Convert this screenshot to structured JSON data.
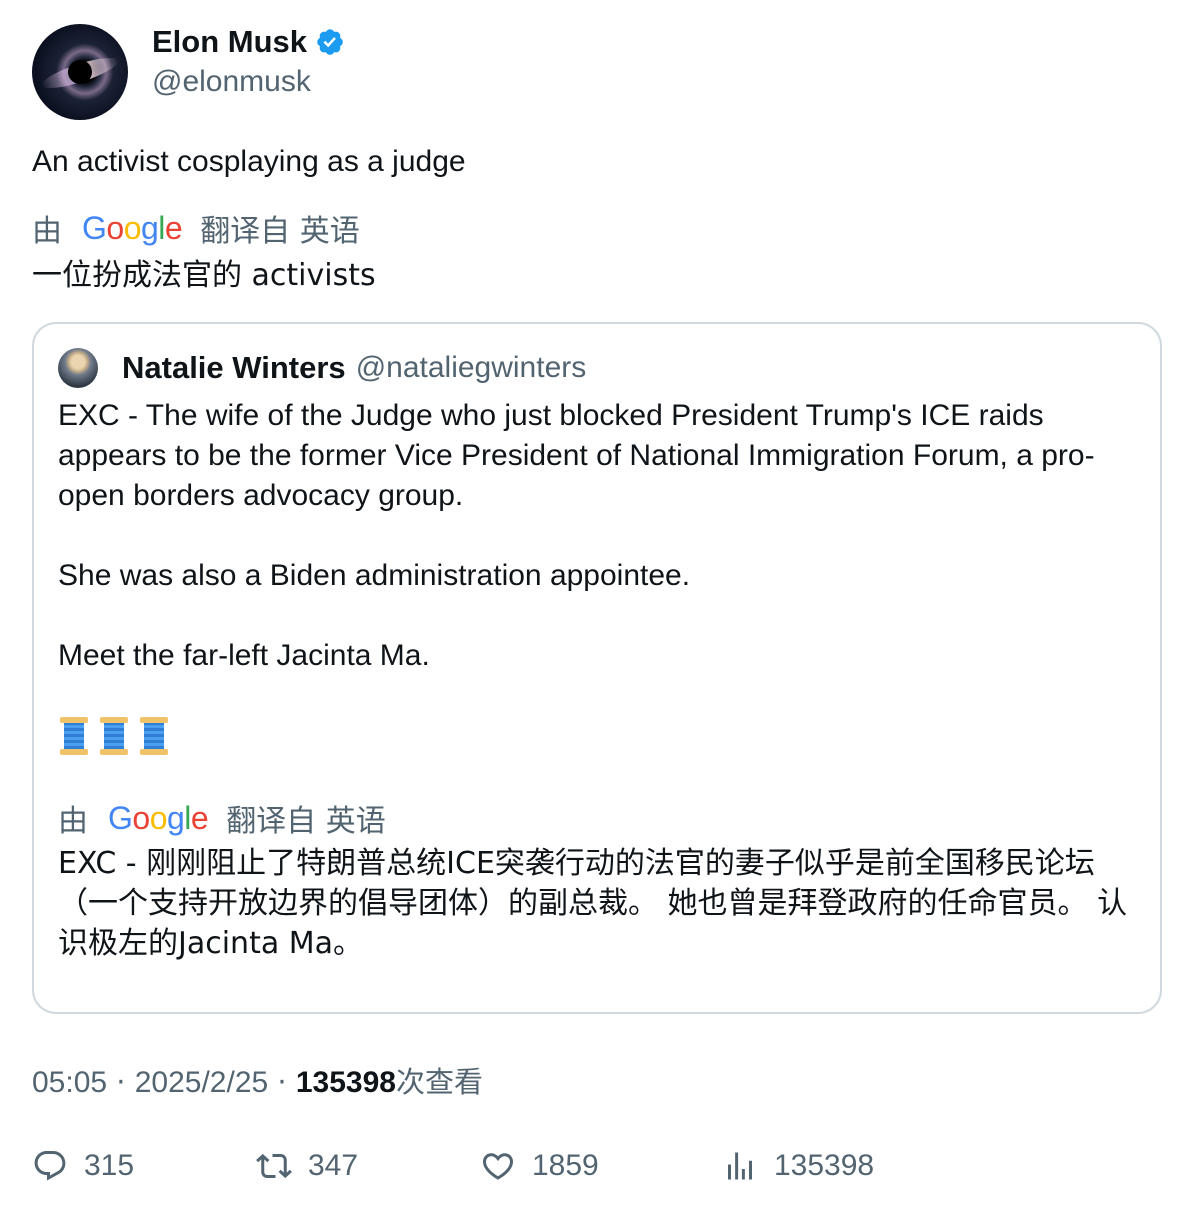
{
  "author": {
    "display_name": "Elon Musk",
    "handle": "@elonmusk",
    "verified": true
  },
  "tweet": {
    "text": "An activist cosplaying as a judge",
    "translation": {
      "by_label": "由",
      "provider": "Google",
      "label": "翻译自 英语",
      "text": "一位扮成法官的 activists"
    }
  },
  "quoted_tweet": {
    "display_name": "Natalie Winters",
    "handle": "@nataliegwinters",
    "paragraphs": [
      "EXC - The wife of the Judge who just blocked President Trump's ICE raids appears to be the former Vice President of National Immigration Forum, a pro-open borders advocacy group.",
      "She was also a Biden administration appointee.",
      "Meet the far-left Jacinta Ma."
    ],
    "translation": {
      "by_label": "由",
      "provider": "Google",
      "label": "翻译自 英语",
      "text": "EXC - 刚刚阻止了特朗普总统ICE突袭行动的法官的妻子似乎是前全国移民论坛（一个支持开放边界的倡导团体）的副总裁。 她也曾是拜登政府的任命官员。 认识极左的Jacinta Ma。"
    }
  },
  "meta": {
    "time": "05:05",
    "separator": "·",
    "date": "2025/2/25",
    "views_count": "135398",
    "views_label": "次查看"
  },
  "actions": {
    "replies": "315",
    "retweets": "347",
    "likes": "1859",
    "views": "135398"
  },
  "colors": {
    "verified": "#1d9bf0",
    "secondary_text": "#536471",
    "border": "#cfd9de",
    "google_blue": "#4285F4",
    "google_red": "#EA4335",
    "google_yellow": "#FBBC05",
    "google_green": "#34A853"
  }
}
